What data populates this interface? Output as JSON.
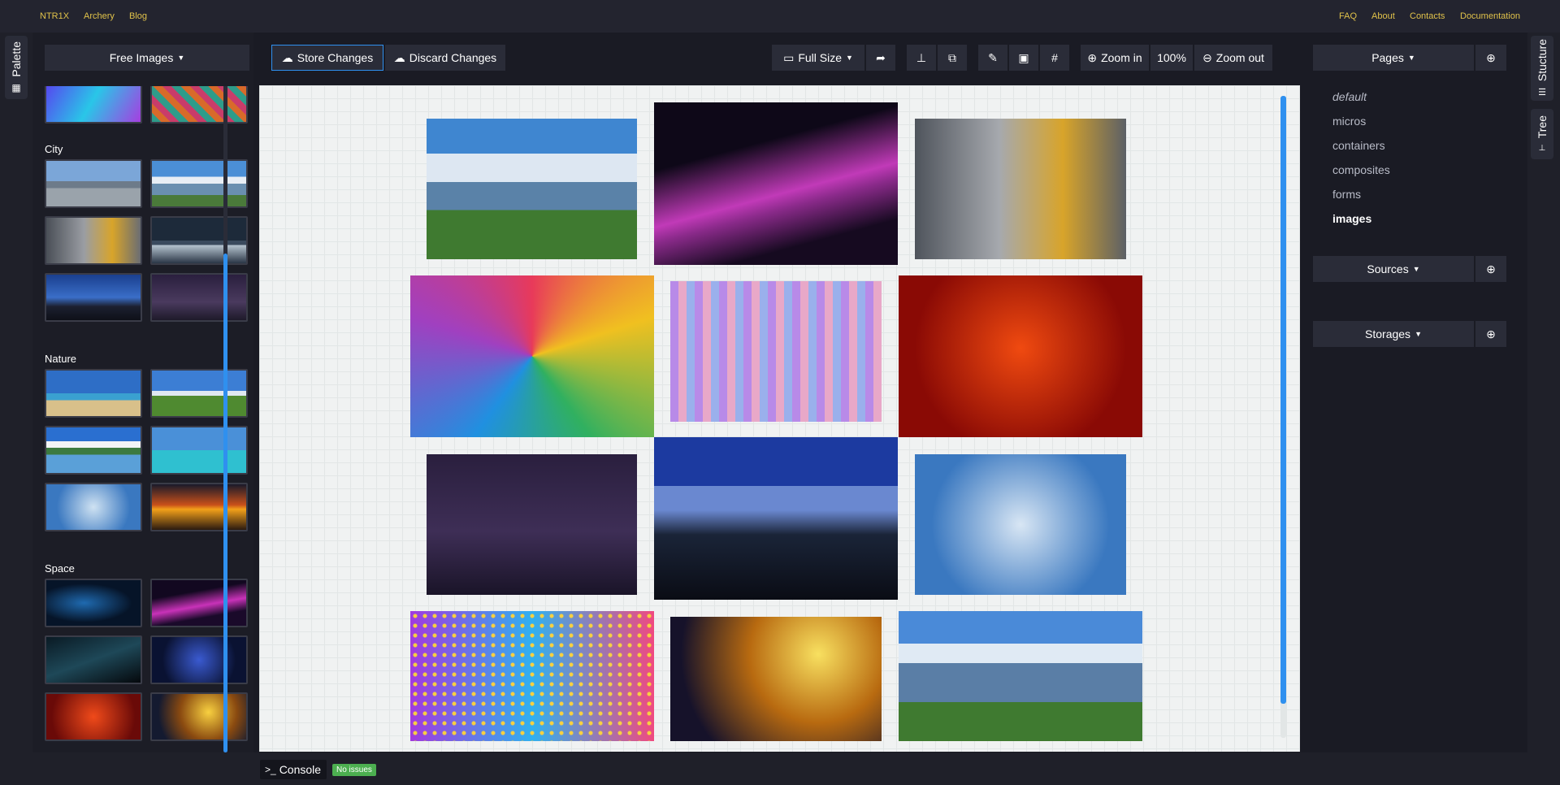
{
  "topnav": {
    "left": [
      "NTR1X",
      "Archery",
      "Blog"
    ],
    "right": [
      "FAQ",
      "About",
      "Contacts",
      "Documentation"
    ]
  },
  "sidetabs": {
    "palette": "Palette",
    "structure": "Stucture",
    "tree": "Tree"
  },
  "palette": {
    "dropdown_label": "Free Images",
    "categories": [
      "City",
      "Nature",
      "Space"
    ]
  },
  "toolbar": {
    "store": "Store Changes",
    "discard": "Discard Changes",
    "fullsize": "Full Size",
    "zoom_in": "Zoom in",
    "zoom_level": "100%",
    "zoom_out": "Zoom out"
  },
  "right": {
    "pages_label": "Pages",
    "pages": [
      "default",
      "micros",
      "containers",
      "composites",
      "forms",
      "images"
    ],
    "active_page": "images",
    "sources_label": "Sources",
    "storages_label": "Storages"
  },
  "bottom": {
    "console": "Console",
    "status": "No issues"
  },
  "colors": {
    "accent": "#2f90ef",
    "link": "#e0c24a",
    "success": "#4caf50"
  }
}
